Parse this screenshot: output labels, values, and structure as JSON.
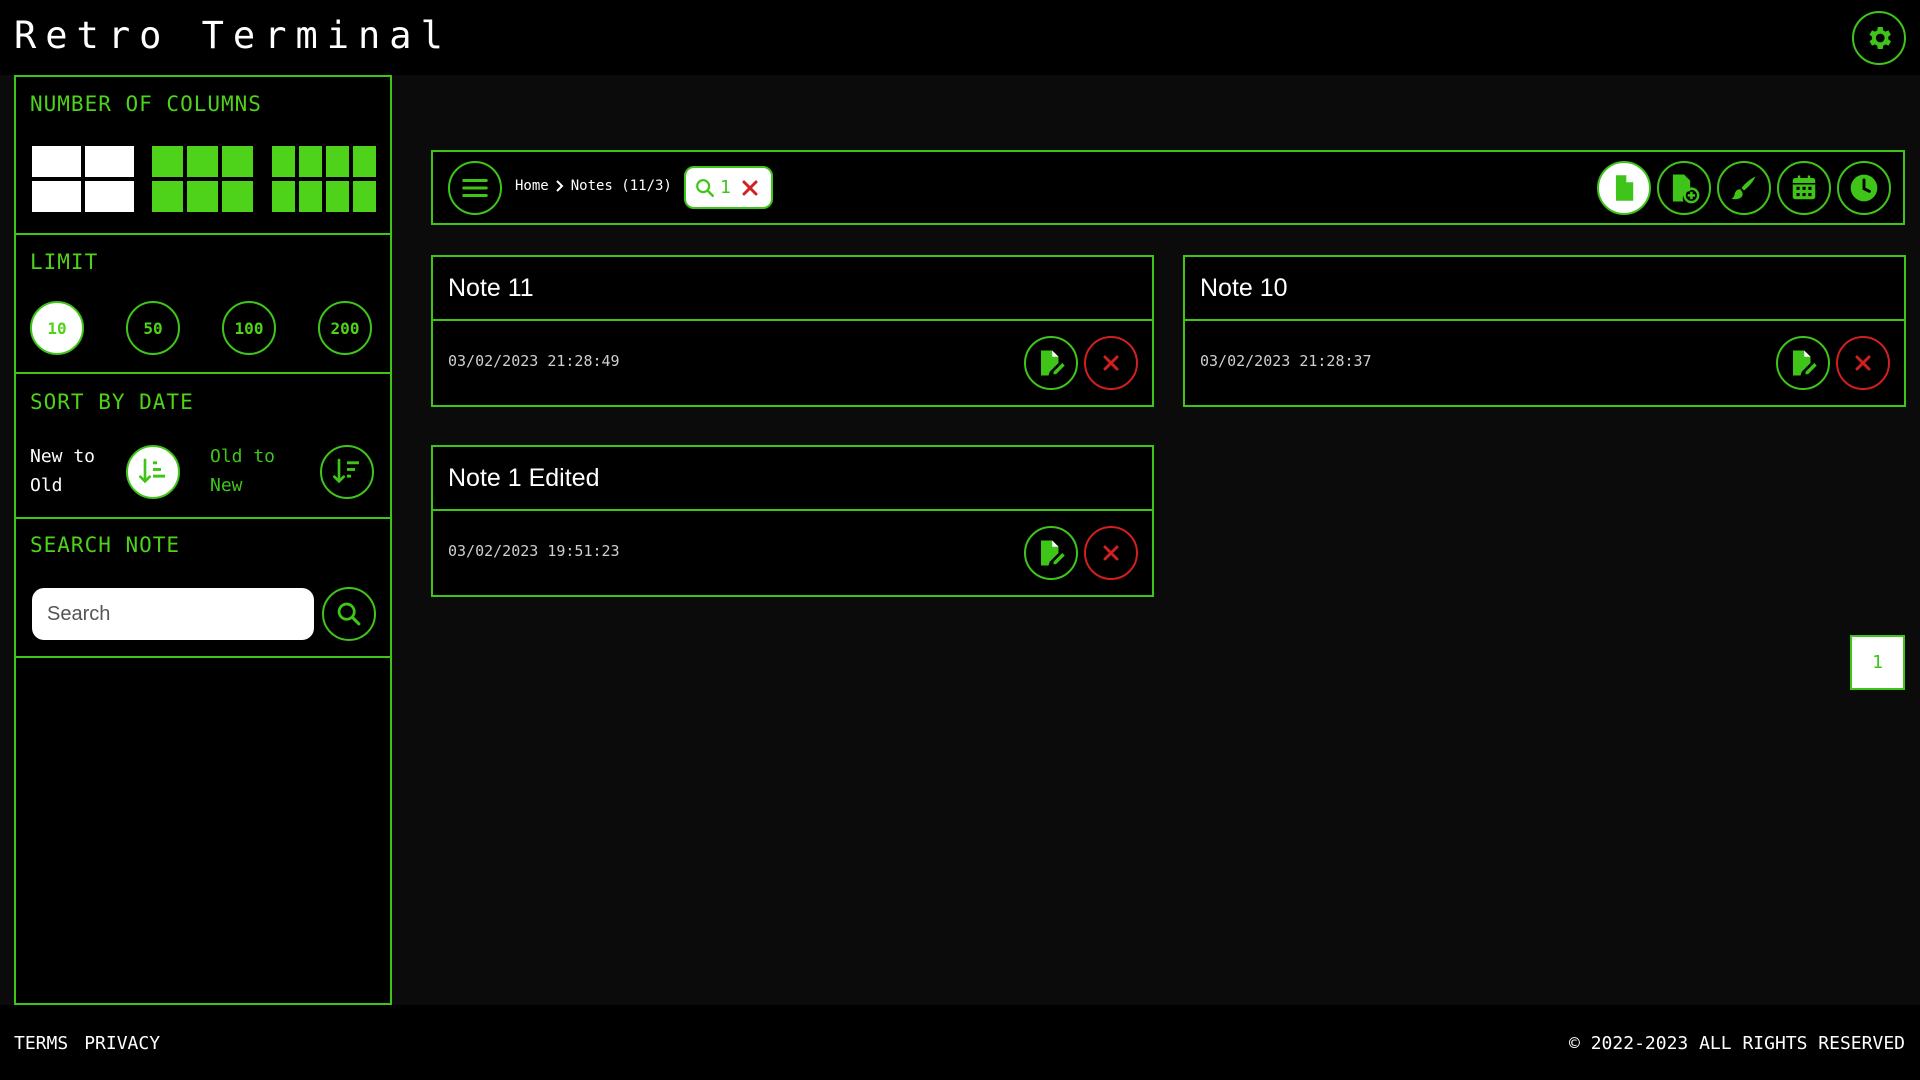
{
  "app": {
    "title": "Retro Terminal"
  },
  "sidebar": {
    "columns": {
      "title": "NUMBER OF COLUMNS",
      "options": [
        2,
        3,
        4
      ],
      "selected": 2
    },
    "limit": {
      "title": "LIMIT",
      "options": [
        "10",
        "50",
        "100",
        "200"
      ],
      "selected": "10"
    },
    "sort": {
      "title": "SORT BY DATE",
      "new_to_old": "New to Old",
      "old_to_new": "Old to New",
      "selected": "new_to_old"
    },
    "search": {
      "title": "SEARCH NOTE",
      "placeholder": "Search",
      "value": ""
    }
  },
  "toolbar": {
    "breadcrumb": [
      "Home",
      "Notes (11/3)"
    ],
    "search_chip": "1",
    "tools": [
      "notes",
      "add-note",
      "theme",
      "calendar",
      "history"
    ],
    "active_tool": "notes"
  },
  "notes": [
    {
      "title": "Note 11",
      "date": "03/02/2023 21:28:49"
    },
    {
      "title": "Note 10",
      "date": "03/02/2023 21:28:37"
    },
    {
      "title": "Note 1 Edited",
      "date": "03/02/2023 19:51:23"
    }
  ],
  "pagination": {
    "current": "1"
  },
  "footer": {
    "terms": "TERMS",
    "privacy": "PRIVACY",
    "copyright": "© 2022-2023 ALL RIGHTS RESERVED"
  },
  "colors": {
    "accent": "#3fc51a",
    "danger": "#d21f1f",
    "background": "#0b0b0b"
  }
}
